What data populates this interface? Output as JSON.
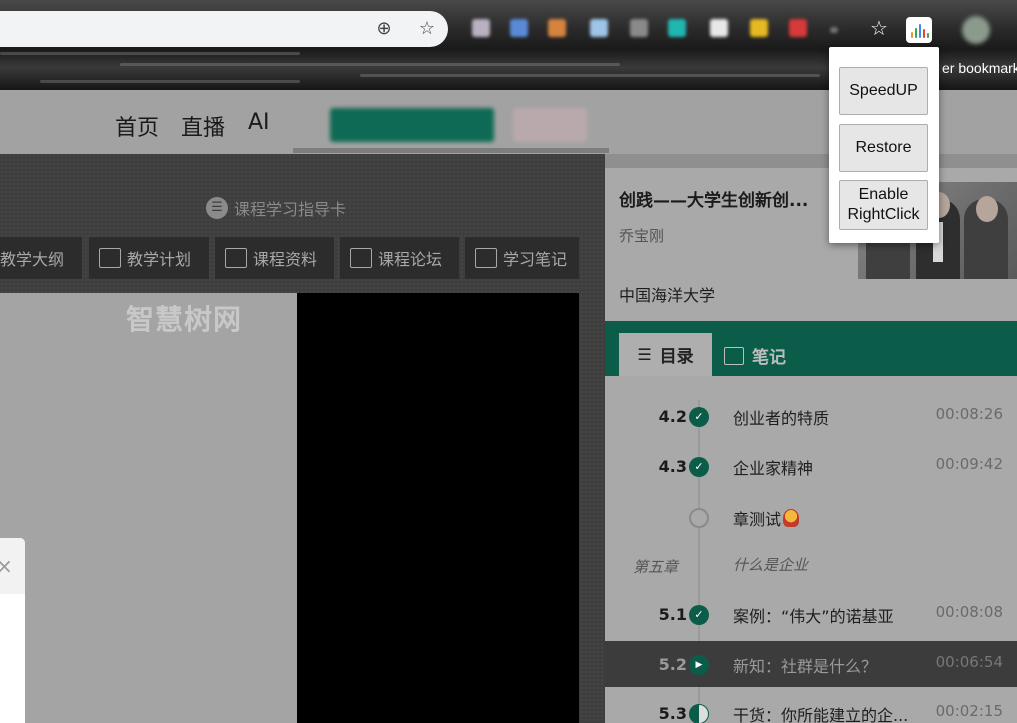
{
  "browser": {
    "bookmark_bar_text": "er bookmark",
    "omnibox_icons": [
      "zoom-icon",
      "star-icon"
    ]
  },
  "site_nav": {
    "items": [
      "首页",
      "直播",
      "AI"
    ]
  },
  "course_tools": {
    "guide_card": "课程学习指导卡",
    "tabs": [
      "教学大纲",
      "教学计划",
      "课程资料",
      "课程论坛",
      "学习笔记"
    ],
    "watermark": "智慧树网"
  },
  "course": {
    "title": "创践——大学生创新创...",
    "teacher": "乔宝刚",
    "school": "中国海洋大学"
  },
  "panel_tabs": {
    "catalog": "目录",
    "notes": "笔记"
  },
  "lessons": [
    {
      "num": "4.2",
      "title": "创业者的特质",
      "time": "00:08:26",
      "status": "done"
    },
    {
      "num": "4.3",
      "title": "企业家精神",
      "time": "00:09:42",
      "status": "done"
    },
    {
      "num": "",
      "title": "章测试",
      "time": "",
      "status": "empty"
    },
    {
      "num": "5.1",
      "title": "案例：“伟大”的诺基亚",
      "time": "00:08:08",
      "status": "done"
    },
    {
      "num": "5.2",
      "title": "新知：社群是什么？",
      "time": "00:06:54",
      "status": "playing"
    },
    {
      "num": "5.3",
      "title": "干货：你所能建立的企...",
      "time": "00:02:15",
      "status": "half"
    }
  ],
  "chapter": {
    "num": "第五章",
    "title": "什么是企业"
  },
  "extension_popup": {
    "speedup": "SpeedUP",
    "restore": "Restore",
    "enable_line1": "Enable",
    "enable_line2": "RightClick"
  },
  "colors": {
    "accent": "#0b5d4a",
    "overlay_dim": "#a9a9a9"
  }
}
